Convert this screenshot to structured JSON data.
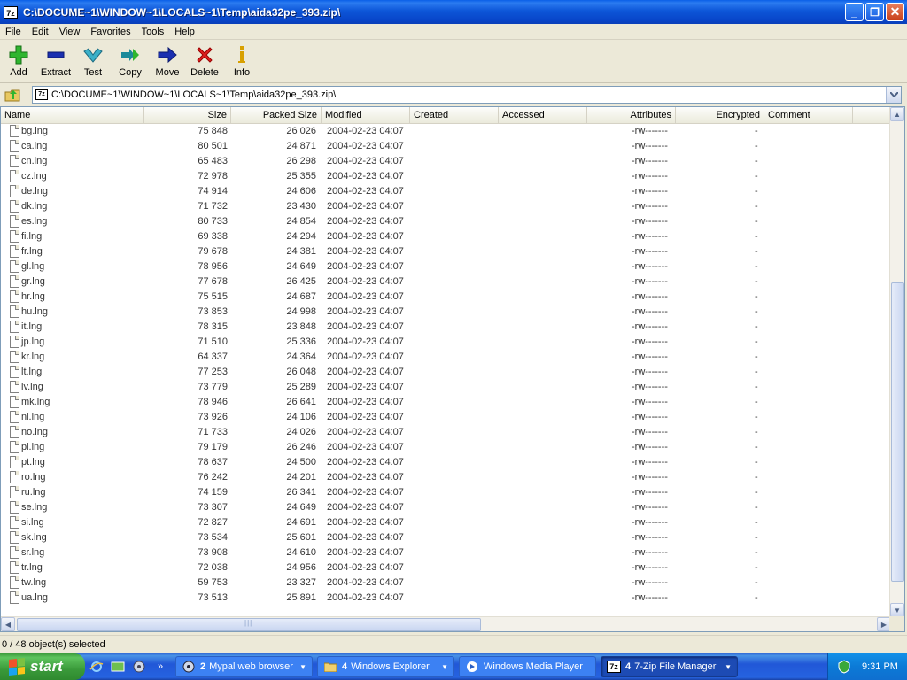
{
  "window": {
    "icon": "7z",
    "title": "C:\\DOCUME~1\\WINDOW~1\\LOCALS~1\\Temp\\aida32pe_393.zip\\",
    "minimize": "_",
    "maximize": "❐",
    "close": "✕"
  },
  "menu": [
    "File",
    "Edit",
    "View",
    "Favorites",
    "Tools",
    "Help"
  ],
  "toolbar": {
    "add": "Add",
    "extract": "Extract",
    "test": "Test",
    "copy": "Copy",
    "move": "Move",
    "delete": "Delete",
    "info": "Info"
  },
  "address": {
    "icon": "7z",
    "path": "C:\\DOCUME~1\\WINDOW~1\\LOCALS~1\\Temp\\aida32pe_393.zip\\"
  },
  "columns": [
    "Name",
    "Size",
    "Packed Size",
    "Modified",
    "Created",
    "Accessed",
    "Attributes",
    "Encrypted",
    "Comment"
  ],
  "rows": [
    {
      "name": "bg.lng",
      "size": "75 848",
      "packed": "26 026",
      "modified": "2004-02-23 04:07",
      "attr": "-rw-------",
      "enc": "-"
    },
    {
      "name": "ca.lng",
      "size": "80 501",
      "packed": "24 871",
      "modified": "2004-02-23 04:07",
      "attr": "-rw-------",
      "enc": "-"
    },
    {
      "name": "cn.lng",
      "size": "65 483",
      "packed": "26 298",
      "modified": "2004-02-23 04:07",
      "attr": "-rw-------",
      "enc": "-"
    },
    {
      "name": "cz.lng",
      "size": "72 978",
      "packed": "25 355",
      "modified": "2004-02-23 04:07",
      "attr": "-rw-------",
      "enc": "-"
    },
    {
      "name": "de.lng",
      "size": "74 914",
      "packed": "24 606",
      "modified": "2004-02-23 04:07",
      "attr": "-rw-------",
      "enc": "-"
    },
    {
      "name": "dk.lng",
      "size": "71 732",
      "packed": "23 430",
      "modified": "2004-02-23 04:07",
      "attr": "-rw-------",
      "enc": "-"
    },
    {
      "name": "es.lng",
      "size": "80 733",
      "packed": "24 854",
      "modified": "2004-02-23 04:07",
      "attr": "-rw-------",
      "enc": "-"
    },
    {
      "name": "fi.lng",
      "size": "69 338",
      "packed": "24 294",
      "modified": "2004-02-23 04:07",
      "attr": "-rw-------",
      "enc": "-"
    },
    {
      "name": "fr.lng",
      "size": "79 678",
      "packed": "24 381",
      "modified": "2004-02-23 04:07",
      "attr": "-rw-------",
      "enc": "-"
    },
    {
      "name": "gl.lng",
      "size": "78 956",
      "packed": "24 649",
      "modified": "2004-02-23 04:07",
      "attr": "-rw-------",
      "enc": "-"
    },
    {
      "name": "gr.lng",
      "size": "77 678",
      "packed": "26 425",
      "modified": "2004-02-23 04:07",
      "attr": "-rw-------",
      "enc": "-"
    },
    {
      "name": "hr.lng",
      "size": "75 515",
      "packed": "24 687",
      "modified": "2004-02-23 04:07",
      "attr": "-rw-------",
      "enc": "-"
    },
    {
      "name": "hu.lng",
      "size": "73 853",
      "packed": "24 998",
      "modified": "2004-02-23 04:07",
      "attr": "-rw-------",
      "enc": "-"
    },
    {
      "name": "it.lng",
      "size": "78 315",
      "packed": "23 848",
      "modified": "2004-02-23 04:07",
      "attr": "-rw-------",
      "enc": "-"
    },
    {
      "name": "jp.lng",
      "size": "71 510",
      "packed": "25 336",
      "modified": "2004-02-23 04:07",
      "attr": "-rw-------",
      "enc": "-"
    },
    {
      "name": "kr.lng",
      "size": "64 337",
      "packed": "24 364",
      "modified": "2004-02-23 04:07",
      "attr": "-rw-------",
      "enc": "-"
    },
    {
      "name": "lt.lng",
      "size": "77 253",
      "packed": "26 048",
      "modified": "2004-02-23 04:07",
      "attr": "-rw-------",
      "enc": "-"
    },
    {
      "name": "lv.lng",
      "size": "73 779",
      "packed": "25 289",
      "modified": "2004-02-23 04:07",
      "attr": "-rw-------",
      "enc": "-"
    },
    {
      "name": "mk.lng",
      "size": "78 946",
      "packed": "26 641",
      "modified": "2004-02-23 04:07",
      "attr": "-rw-------",
      "enc": "-"
    },
    {
      "name": "nl.lng",
      "size": "73 926",
      "packed": "24 106",
      "modified": "2004-02-23 04:07",
      "attr": "-rw-------",
      "enc": "-"
    },
    {
      "name": "no.lng",
      "size": "71 733",
      "packed": "24 026",
      "modified": "2004-02-23 04:07",
      "attr": "-rw-------",
      "enc": "-"
    },
    {
      "name": "pl.lng",
      "size": "79 179",
      "packed": "26 246",
      "modified": "2004-02-23 04:07",
      "attr": "-rw-------",
      "enc": "-"
    },
    {
      "name": "pt.lng",
      "size": "78 637",
      "packed": "24 500",
      "modified": "2004-02-23 04:07",
      "attr": "-rw-------",
      "enc": "-"
    },
    {
      "name": "ro.lng",
      "size": "76 242",
      "packed": "24 201",
      "modified": "2004-02-23 04:07",
      "attr": "-rw-------",
      "enc": "-"
    },
    {
      "name": "ru.lng",
      "size": "74 159",
      "packed": "26 341",
      "modified": "2004-02-23 04:07",
      "attr": "-rw-------",
      "enc": "-"
    },
    {
      "name": "se.lng",
      "size": "73 307",
      "packed": "24 649",
      "modified": "2004-02-23 04:07",
      "attr": "-rw-------",
      "enc": "-"
    },
    {
      "name": "si.lng",
      "size": "72 827",
      "packed": "24 691",
      "modified": "2004-02-23 04:07",
      "attr": "-rw-------",
      "enc": "-"
    },
    {
      "name": "sk.lng",
      "size": "73 534",
      "packed": "25 601",
      "modified": "2004-02-23 04:07",
      "attr": "-rw-------",
      "enc": "-"
    },
    {
      "name": "sr.lng",
      "size": "73 908",
      "packed": "24 610",
      "modified": "2004-02-23 04:07",
      "attr": "-rw-------",
      "enc": "-"
    },
    {
      "name": "tr.lng",
      "size": "72 038",
      "packed": "24 956",
      "modified": "2004-02-23 04:07",
      "attr": "-rw-------",
      "enc": "-"
    },
    {
      "name": "tw.lng",
      "size": "59 753",
      "packed": "23 327",
      "modified": "2004-02-23 04:07",
      "attr": "-rw-------",
      "enc": "-"
    },
    {
      "name": "ua.lng",
      "size": "73 513",
      "packed": "25 891",
      "modified": "2004-02-23 04:07",
      "attr": "-rw-------",
      "enc": "-"
    }
  ],
  "status": "0 / 48 object(s) selected",
  "taskbar": {
    "start": "start",
    "tasks": [
      {
        "count": "2",
        "label": "Mypal web browser",
        "icon": "mypal-icon",
        "arrow": "▼"
      },
      {
        "count": "4",
        "label": "Windows Explorer",
        "icon": "folder-icon",
        "arrow": "▼"
      },
      {
        "count": "",
        "label": "Windows Media Player",
        "icon": "media-player-icon",
        "arrow": ""
      },
      {
        "count": "4",
        "label": "7-Zip File Manager",
        "icon": "7zip-icon",
        "arrow": "▼"
      }
    ],
    "quicklaunch_more": "»",
    "clock": "9:31 PM"
  },
  "colors": {
    "titlebar": "#0845c9",
    "taskbar": "#2157d7",
    "start": "#3a9a3a",
    "add": "#2fb52f",
    "extract": "#1a2fb0",
    "test": "#3ab0c8",
    "copy": "#1a8a9a",
    "move": "#1a2fb0",
    "delete": "#e02020",
    "info": "#d8a000"
  }
}
